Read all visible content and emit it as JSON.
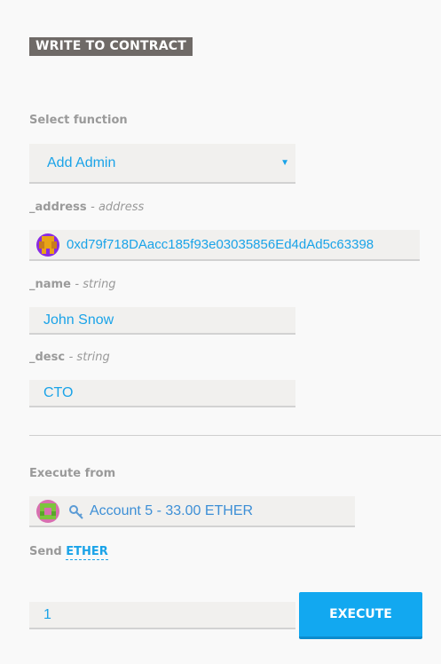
{
  "header": {
    "title": "WRITE TO CONTRACT"
  },
  "select_function": {
    "label": "Select function",
    "selected": "Add Admin",
    "arrow_glyph": "▼",
    "arrow_icon": "caret-down-icon"
  },
  "params": {
    "address": {
      "name": "_address",
      "type": "- address",
      "value": "0xd79f718DAacc185f93e03035856Ed4dAd5c63398",
      "icon": "identicon"
    },
    "name": {
      "name": "_name",
      "type": "- string",
      "value": "John Snow"
    },
    "desc": {
      "name": "_desc",
      "type": "- string",
      "value": "CTO"
    }
  },
  "execute_from": {
    "label": "Execute from",
    "account_text": "Account 5 - 33.00 ETHER",
    "key_icon": "key-icon",
    "avatar_icon": "identicon"
  },
  "send": {
    "label": "Send",
    "unit": "ETHER",
    "amount": "1"
  },
  "execute_button": {
    "label": "EXECUTE"
  },
  "colors": {
    "accent": "#12a8f0",
    "header_bg": "#6f6a67",
    "field_bg": "#f1f0ee"
  }
}
